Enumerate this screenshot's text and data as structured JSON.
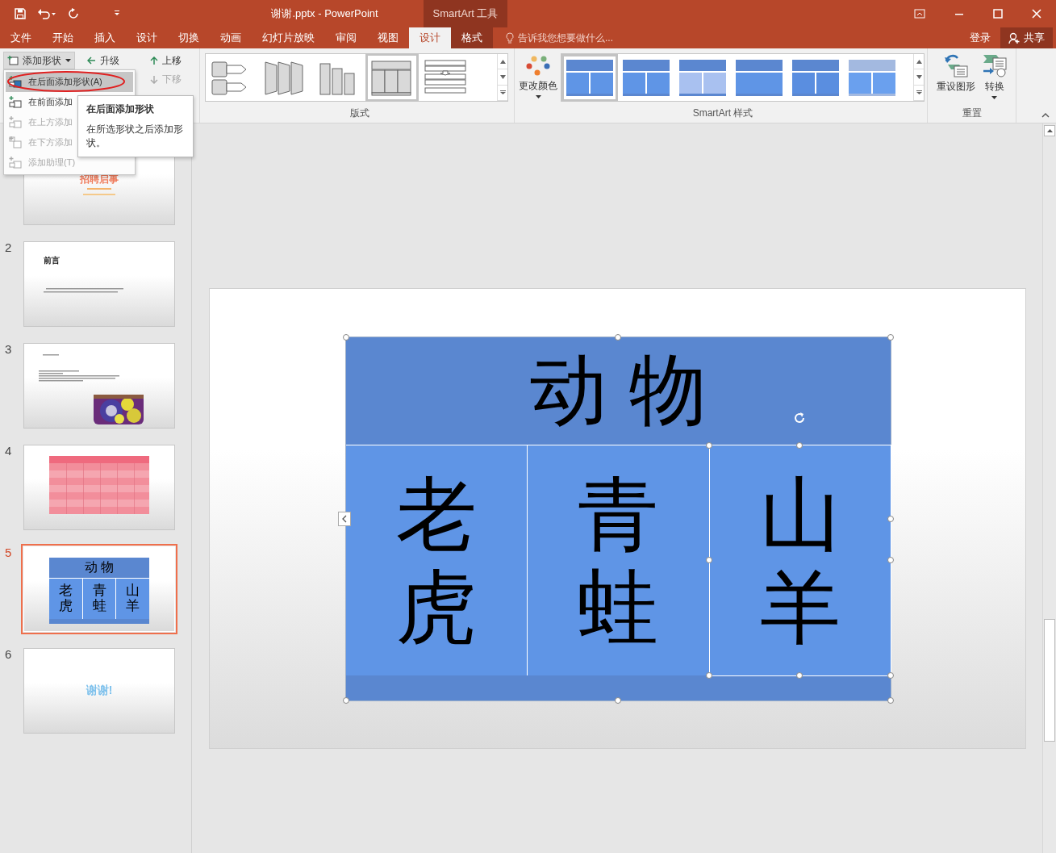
{
  "window": {
    "title": "谢谢.pptx - PowerPoint",
    "context_group": "SmartArt 工具"
  },
  "tabs": [
    {
      "label": "文件",
      "selected": false,
      "kind": "normal"
    },
    {
      "label": "开始",
      "selected": false,
      "kind": "normal"
    },
    {
      "label": "插入",
      "selected": false,
      "kind": "normal"
    },
    {
      "label": "设计",
      "selected": false,
      "kind": "normal"
    },
    {
      "label": "切换",
      "selected": false,
      "kind": "normal"
    },
    {
      "label": "动画",
      "selected": false,
      "kind": "normal"
    },
    {
      "label": "幻灯片放映",
      "selected": false,
      "kind": "normal"
    },
    {
      "label": "审阅",
      "selected": false,
      "kind": "normal"
    },
    {
      "label": "视图",
      "selected": false,
      "kind": "normal"
    },
    {
      "label": "设计",
      "selected": true,
      "kind": "context"
    },
    {
      "label": "格式",
      "selected": false,
      "kind": "context"
    }
  ],
  "tell_me": {
    "placeholder": "告诉我您想要做什么..."
  },
  "account": {
    "sign_in": "登录",
    "share": "共享"
  },
  "ribbon": {
    "create_graphic": [
      {
        "label": "添加形状",
        "kind": "dropdown",
        "disabled": false
      },
      {
        "label": "升级",
        "kind": "promote",
        "disabled": false
      },
      {
        "label": "上移",
        "kind": "up",
        "disabled": false
      },
      {
        "label": "下移",
        "kind": "down",
        "disabled": true
      }
    ],
    "layouts": {
      "label": "版式",
      "items": [
        {
          "selected": false
        },
        {
          "selected": false
        },
        {
          "selected": false
        },
        {
          "selected": true
        },
        {
          "selected": false
        }
      ]
    },
    "styles": {
      "label": "SmartArt 样式",
      "change_colors": "更改颜色",
      "items": [
        {
          "selected": true
        },
        {
          "selected": false
        },
        {
          "selected": false
        },
        {
          "selected": false
        },
        {
          "selected": false
        },
        {
          "selected": false
        }
      ]
    },
    "reset": {
      "label": "重置",
      "buttons": [
        {
          "label": "重设图形",
          "kind": "reset"
        },
        {
          "label": "转换",
          "kind": "convert"
        }
      ]
    }
  },
  "menu": {
    "items": [
      {
        "label": "在后面添加形状(A)",
        "selected": true,
        "disabled": false
      },
      {
        "label": "在前面添加",
        "selected": false,
        "disabled": false
      },
      {
        "label": "在上方添加",
        "selected": false,
        "disabled": true
      },
      {
        "label": "在下方添加",
        "selected": false,
        "disabled": true
      },
      {
        "label": "添加助理(T)",
        "selected": false,
        "disabled": true
      }
    ]
  },
  "tooltip": {
    "title": "在后面添加形状",
    "body": "在所选形状之后添加形状。"
  },
  "slides": [
    {
      "selected": false,
      "kind": "title",
      "title": "招聘启事"
    },
    {
      "number": "2",
      "selected": false,
      "kind": "text",
      "title": "前言"
    },
    {
      "number": "3",
      "selected": false,
      "kind": "text_picture"
    },
    {
      "number": "4",
      "selected": false,
      "kind": "table"
    },
    {
      "number": "5",
      "selected": true,
      "kind": "smartart",
      "header": "动 物",
      "cells": [
        "老虎",
        "青蛙",
        "山羊"
      ]
    },
    {
      "number": "6",
      "selected": false,
      "kind": "closing",
      "title": "谢谢!"
    }
  ],
  "smartart": {
    "header": "动 物",
    "cells": [
      {
        "label": "老虎",
        "selected": false
      },
      {
        "label": "青蛙",
        "selected": false
      },
      {
        "label": "山羊",
        "selected": true
      }
    ]
  }
}
